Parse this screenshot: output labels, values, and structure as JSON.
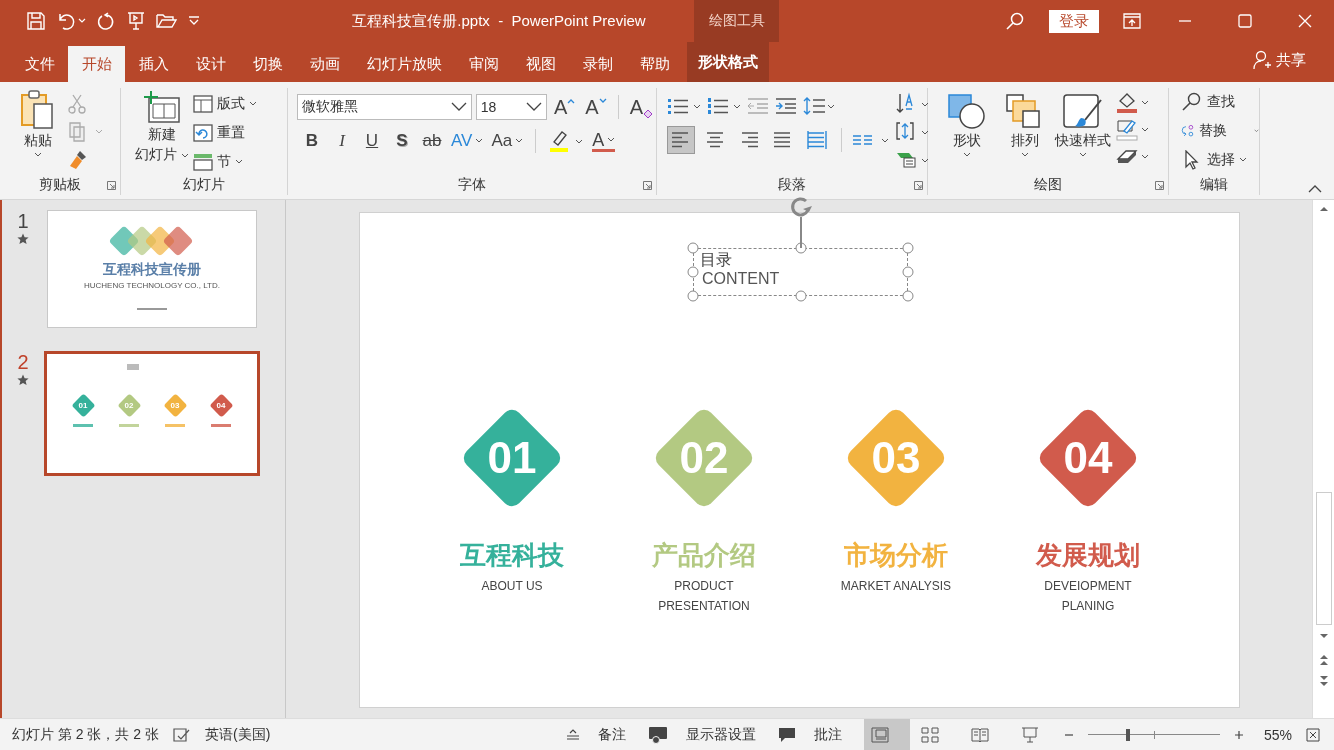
{
  "title_bar": {
    "title": "互程科技宣传册.pptx  -  PowerPoint Preview",
    "context_label": "绘图工具",
    "sign_in": "登录"
  },
  "tabs": [
    {
      "label": "文件",
      "selected": false,
      "kind": "normal"
    },
    {
      "label": "开始",
      "selected": true,
      "kind": "normal"
    },
    {
      "label": "插入",
      "selected": false,
      "kind": "normal"
    },
    {
      "label": "设计",
      "selected": false,
      "kind": "normal"
    },
    {
      "label": "切换",
      "selected": false,
      "kind": "normal"
    },
    {
      "label": "动画",
      "selected": false,
      "kind": "normal"
    },
    {
      "label": "幻灯片放映",
      "selected": false,
      "kind": "normal"
    },
    {
      "label": "审阅",
      "selected": false,
      "kind": "normal"
    },
    {
      "label": "视图",
      "selected": false,
      "kind": "normal"
    },
    {
      "label": "录制",
      "selected": false,
      "kind": "normal"
    },
    {
      "label": "帮助",
      "selected": false,
      "kind": "normal"
    },
    {
      "label": "形状格式",
      "selected": false,
      "kind": "contextual"
    }
  ],
  "share": "共享",
  "ribbon": {
    "clipboard": {
      "label": "剪贴板",
      "paste": "粘贴"
    },
    "slides": {
      "label": "幻灯片",
      "new_slide": [
        "新建",
        "幻灯片"
      ],
      "layout": "版式",
      "reset": "重置",
      "section": "节"
    },
    "font": {
      "label": "字体",
      "name": "微软雅黑",
      "size": "18",
      "grow": "A",
      "shrink": "A",
      "clear": "A",
      "font_color": "A",
      "styles": [
        {
          "text": "B",
          "kind": "bold"
        },
        {
          "text": "I",
          "kind": "italic"
        },
        {
          "text": "U",
          "kind": "underline"
        },
        {
          "text": "S",
          "kind": "shadow"
        },
        {
          "text": "ab",
          "kind": "strike"
        },
        {
          "text": "AV",
          "kind": "spacing"
        },
        {
          "text": "Aa",
          "kind": "case"
        }
      ]
    },
    "paragraph": {
      "label": "段落",
      "alignment": [
        {
          "kind": "left",
          "selected": true
        },
        {
          "kind": "center",
          "selected": false
        },
        {
          "kind": "right",
          "selected": false
        },
        {
          "kind": "justify",
          "selected": false
        },
        {
          "kind": "distributed",
          "selected": false
        }
      ]
    },
    "drawing": {
      "label": "绘图",
      "shapes": "形状",
      "arrange": "排列",
      "quick_styles": "快速样式"
    },
    "editing": {
      "label": "编辑",
      "find": "查找",
      "replace": "替换",
      "select": "选择"
    }
  },
  "slides_pane": [
    {
      "number": "1",
      "selected": false,
      "kind": "cover",
      "title": "互程科技宣传册",
      "subtitle": "HUCHENG TECHNOLOGY CO., LTD."
    },
    {
      "number": "2",
      "selected": true,
      "kind": "contents",
      "items": [
        {
          "number": "01",
          "color": "#35b19b"
        },
        {
          "number": "02",
          "color": "#b3c982"
        },
        {
          "number": "03",
          "color": "#f2b340"
        },
        {
          "number": "04",
          "color": "#d15b4c"
        }
      ]
    }
  ],
  "slide": {
    "title": "目录",
    "subtitle": "CONTENT",
    "items": [
      {
        "number": "01",
        "title": "互程科技",
        "caption": [
          "ABOUT US"
        ],
        "color": "#35b19b"
      },
      {
        "number": "02",
        "title": "产品介绍",
        "caption": [
          "PRODUCT",
          "PRESENTATION"
        ],
        "color": "#b3c982"
      },
      {
        "number": "03",
        "title": "市场分析",
        "caption": [
          "MARKET ANALYSIS"
        ],
        "color": "#f2b340"
      },
      {
        "number": "04",
        "title": "发展规划",
        "caption": [
          "DEVEIOPMENT",
          "PLANING"
        ],
        "color": "#d15b4c"
      }
    ]
  },
  "status_bar": {
    "slide_info": "幻灯片 第 2 张，共 2 张",
    "language": "英语(美国)",
    "notes": "备注",
    "display": "显示器设置",
    "comments": "批注",
    "views": [
      {
        "kind": "normal",
        "selected": true
      },
      {
        "kind": "sorter",
        "selected": false
      },
      {
        "kind": "reading",
        "selected": false
      },
      {
        "kind": "slideshow",
        "selected": false
      }
    ],
    "zoom": {
      "level": 0.3,
      "reading": "55%"
    }
  }
}
